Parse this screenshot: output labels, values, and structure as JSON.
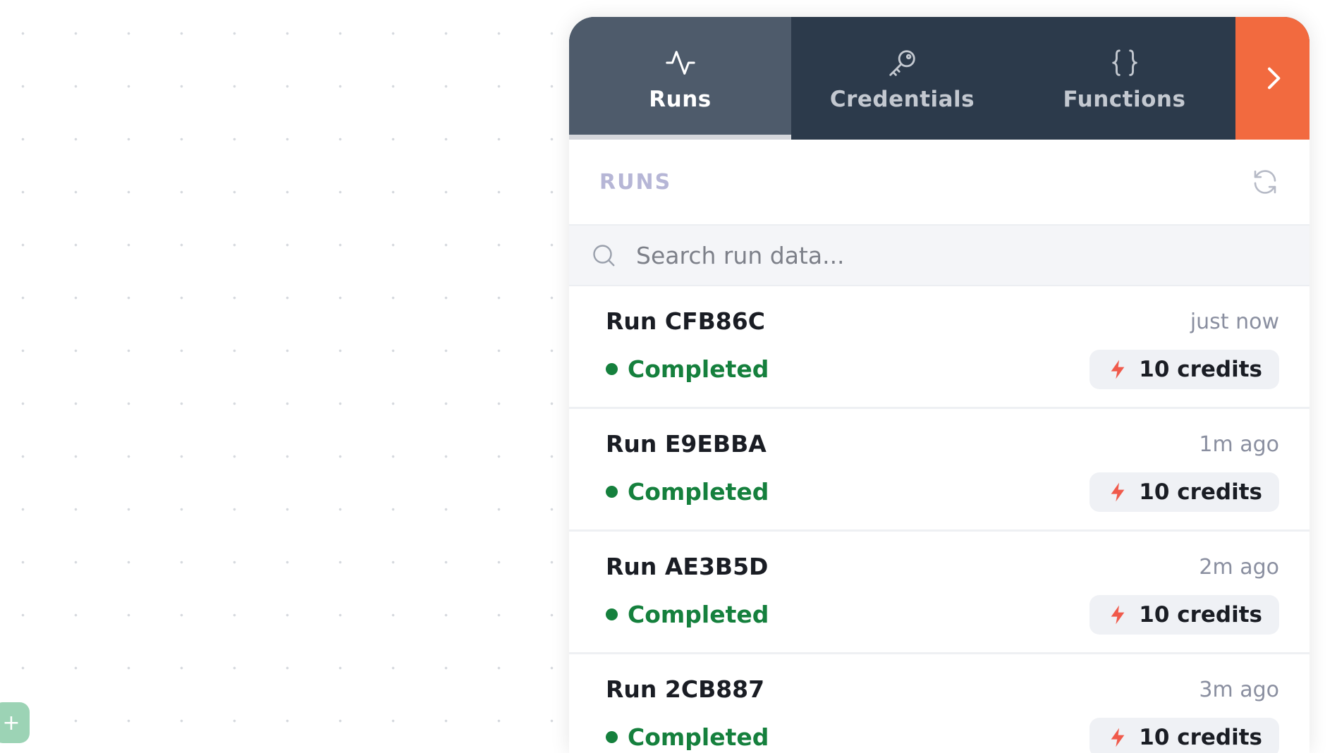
{
  "tabs": [
    {
      "label": "Runs",
      "icon": "activity-icon",
      "active": true
    },
    {
      "label": "Credentials",
      "icon": "key-icon",
      "active": false
    },
    {
      "label": "Functions",
      "icon": "braces-icon",
      "active": false
    }
  ],
  "runs_header": {
    "title": "RUNS"
  },
  "search": {
    "placeholder": "Search run data..."
  },
  "runs": [
    {
      "name": "Run CFB86C",
      "time": "just now",
      "status": "Completed",
      "credits": "10 credits"
    },
    {
      "name": "Run E9EBBA",
      "time": "1m ago",
      "status": "Completed",
      "credits": "10 credits"
    },
    {
      "name": "Run AE3B5D",
      "time": "2m ago",
      "status": "Completed",
      "credits": "10 credits"
    },
    {
      "name": "Run 2CB887",
      "time": "3m ago",
      "status": "Completed",
      "credits": "10 credits"
    }
  ],
  "add_button": {
    "label": "+"
  },
  "colors": {
    "accent": "#f26a3f",
    "tab_bar": "#2c3a4b",
    "tab_active": "#4e5b6b",
    "status_completed": "#15803d",
    "credits_bolt": "#f05a4b"
  }
}
